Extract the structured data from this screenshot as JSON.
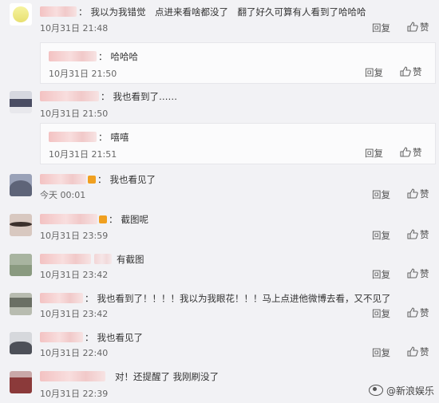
{
  "labels": {
    "reply": "回复",
    "like": "赞",
    "sep": "："
  },
  "comments": [
    {
      "text": "我以为我错觉　点进来看啥都没了　翻了好久可算有人看到了哈哈哈",
      "time": "10月31日 21:48"
    },
    {
      "text": "哈哈哈",
      "time": "10月31日 21:50"
    },
    {
      "text": "我也看到了……",
      "time": "10月31日 21:50"
    },
    {
      "text": "嘻嘻",
      "time": "10月31日 21:51"
    },
    {
      "text": "我也看见了",
      "time": "今天 00:01"
    },
    {
      "text": "截图呢",
      "time": "10月31日 23:59"
    },
    {
      "text": "有截图",
      "time": "10月31日 23:42"
    },
    {
      "text": "我也看到了！！！！我以为我眼花！！！马上点进他微博去看，又不见了",
      "time": "10月31日 23:42"
    },
    {
      "text": "我也看见了",
      "time": "10月31日 22:40"
    },
    {
      "text": "对！还提醒了 我刚刷没了",
      "time": "10月31日 22:39"
    }
  ],
  "watermark": "@新浪娱乐"
}
